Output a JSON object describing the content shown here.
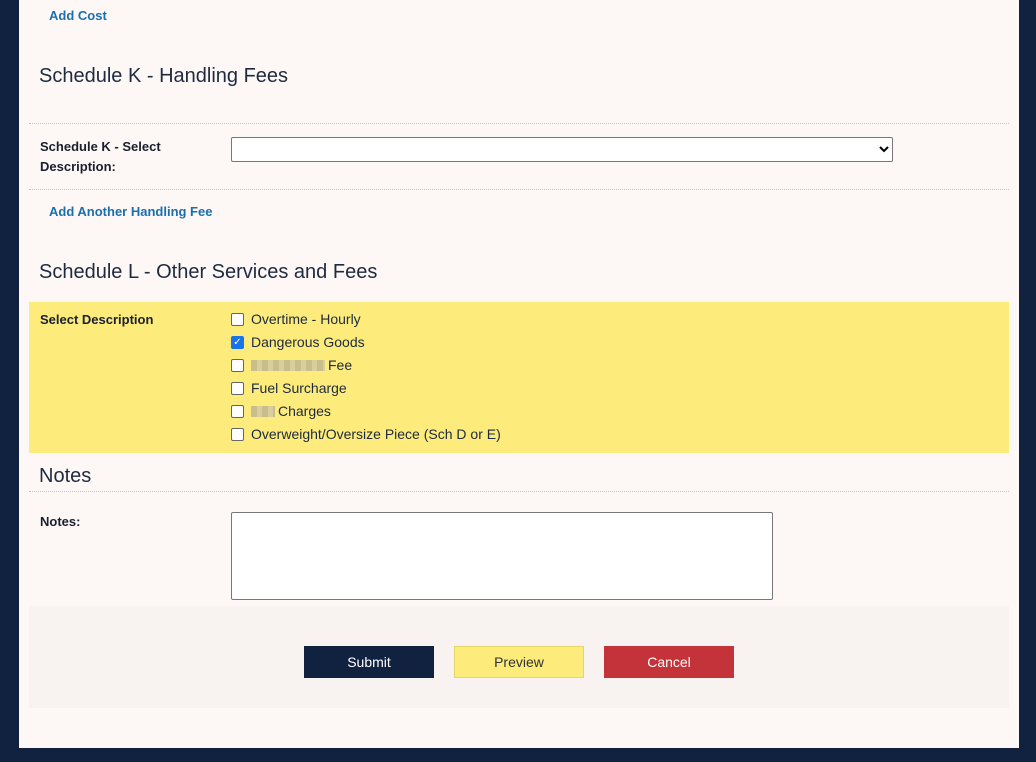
{
  "links": {
    "add_cost": "Add Cost",
    "add_handling_fee": "Add Another Handling Fee"
  },
  "schedule_k": {
    "title": "Schedule K - Handling Fees",
    "label_line1": "Schedule K - Select",
    "label_line2": "Description:",
    "selected": ""
  },
  "schedule_l": {
    "title": "Schedule L - Other Services and Fees",
    "label": "Select Description",
    "options": [
      {
        "label": "Overtime - Hourly",
        "checked": false
      },
      {
        "label": "Dangerous Goods",
        "checked": true
      },
      {
        "label": "Fee",
        "checked": false
      },
      {
        "label": "Fuel Surcharge",
        "checked": false
      },
      {
        "label": "Charges",
        "checked": false
      },
      {
        "label": "Overweight/Oversize Piece (Sch D or E)",
        "checked": false
      }
    ]
  },
  "notes": {
    "title": "Notes",
    "label": "Notes:",
    "value": ""
  },
  "buttons": {
    "submit": "Submit",
    "preview": "Preview",
    "cancel": "Cancel"
  },
  "colors": {
    "submit": "#10223f",
    "preview": "#fdeb7b",
    "cancel": "#c4323a"
  }
}
